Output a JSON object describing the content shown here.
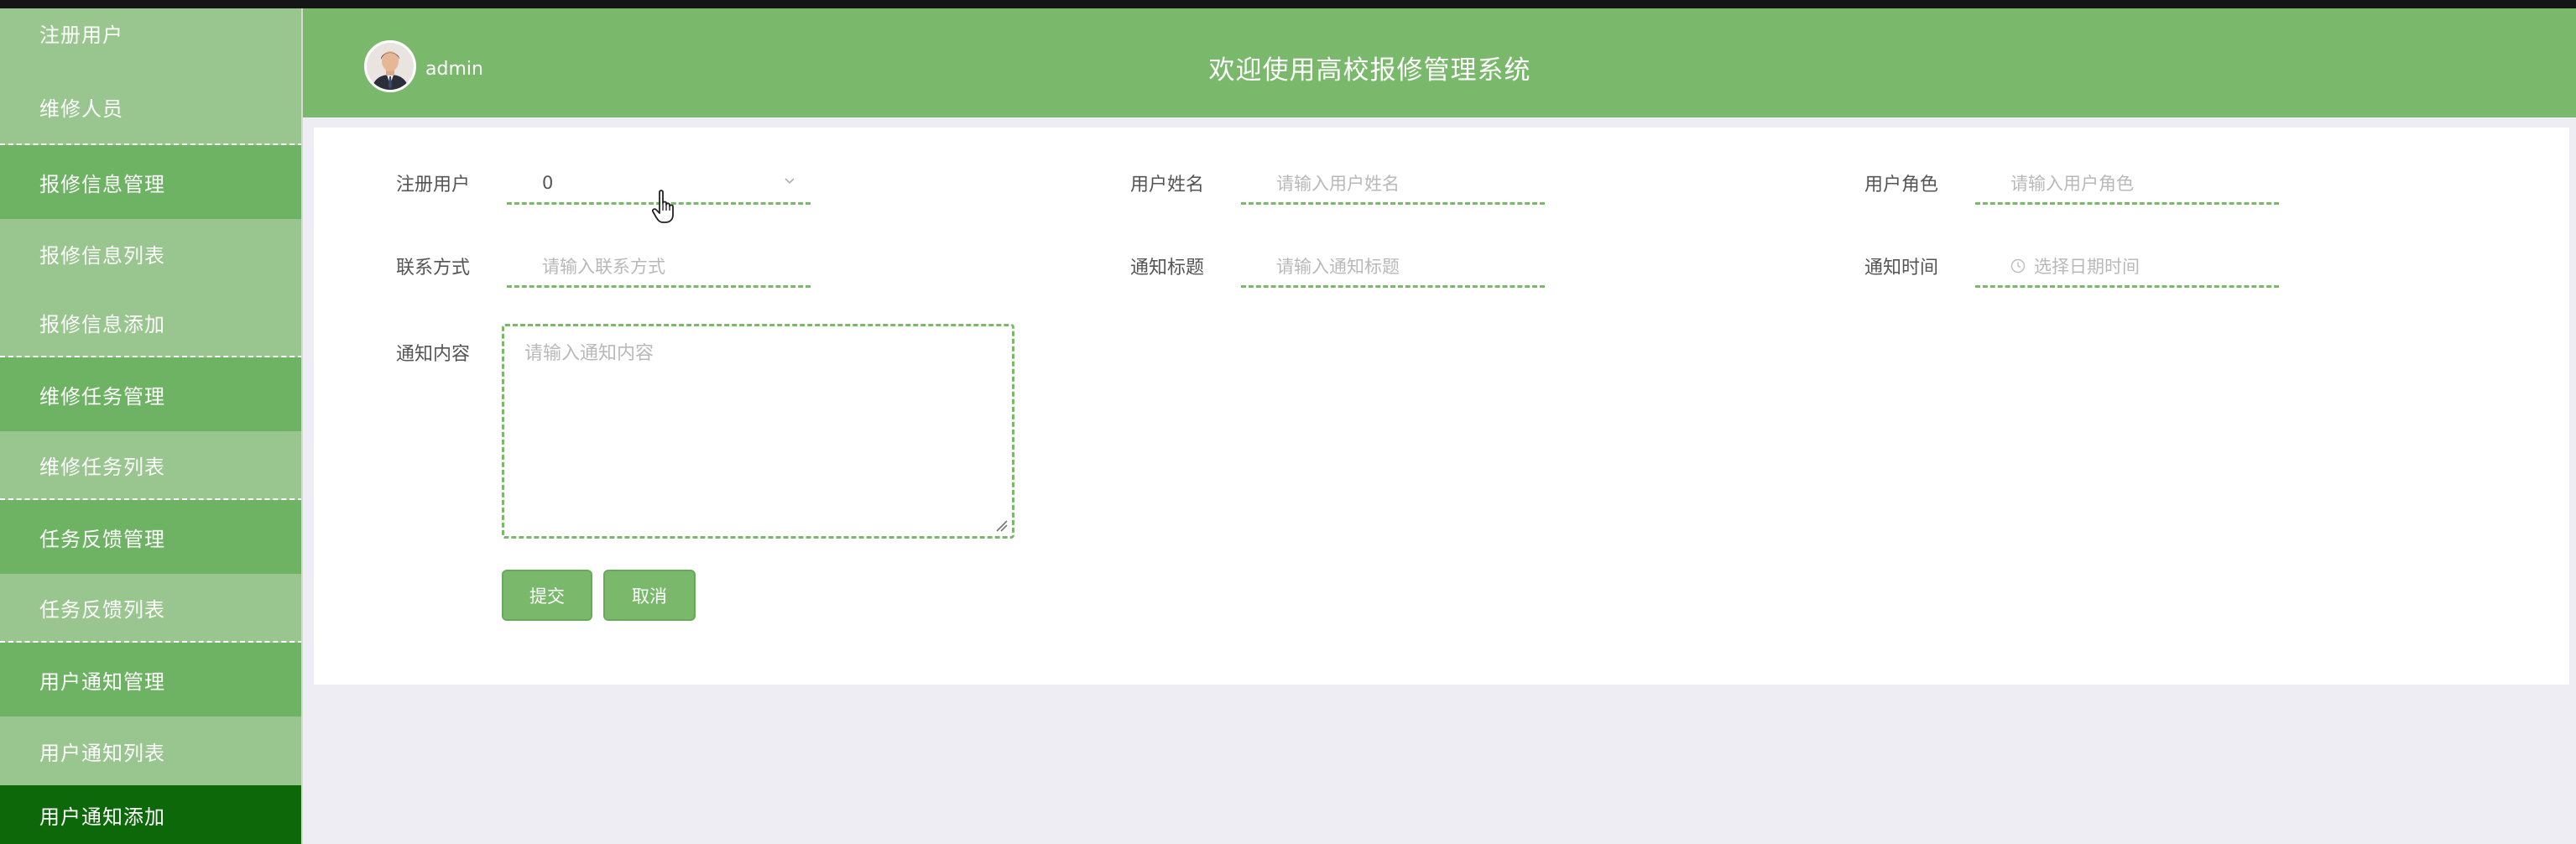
{
  "sidebar": {
    "items": [
      {
        "label": "注册用户",
        "type": "sub"
      },
      {
        "label": "维修人员",
        "type": "sub"
      },
      {
        "label": "报修信息管理",
        "type": "group"
      },
      {
        "label": "报修信息列表",
        "type": "sub"
      },
      {
        "label": "报修信息添加",
        "type": "sub"
      },
      {
        "label": "维修任务管理",
        "type": "group"
      },
      {
        "label": "维修任务列表",
        "type": "sub"
      },
      {
        "label": "任务反馈管理",
        "type": "group"
      },
      {
        "label": "任务反馈列表",
        "type": "sub"
      },
      {
        "label": "用户通知管理",
        "type": "group"
      },
      {
        "label": "用户通知列表",
        "type": "sub"
      },
      {
        "label": "用户通知添加",
        "type": "active"
      }
    ]
  },
  "header": {
    "user_name": "admin",
    "title": "欢迎使用高校报修管理系统"
  },
  "form": {
    "registered_user": {
      "label": "注册用户",
      "value": "0"
    },
    "user_name": {
      "label": "用户姓名",
      "placeholder": "请输入用户姓名"
    },
    "user_role": {
      "label": "用户角色",
      "placeholder": "请输入用户角色"
    },
    "contact": {
      "label": "联系方式",
      "placeholder": "请输入联系方式"
    },
    "notice_title": {
      "label": "通知标题",
      "placeholder": "请输入通知标题"
    },
    "notice_time": {
      "label": "通知时间",
      "placeholder": "选择日期时间"
    },
    "notice_content": {
      "label": "通知内容",
      "placeholder": "请输入通知内容"
    },
    "submit_label": "提交",
    "cancel_label": "取消"
  },
  "colors": {
    "accent": "#7ab96c",
    "sidebar_group": "#6db363",
    "sidebar_sub": "#99c68e",
    "sidebar_active": "#0c6809"
  }
}
